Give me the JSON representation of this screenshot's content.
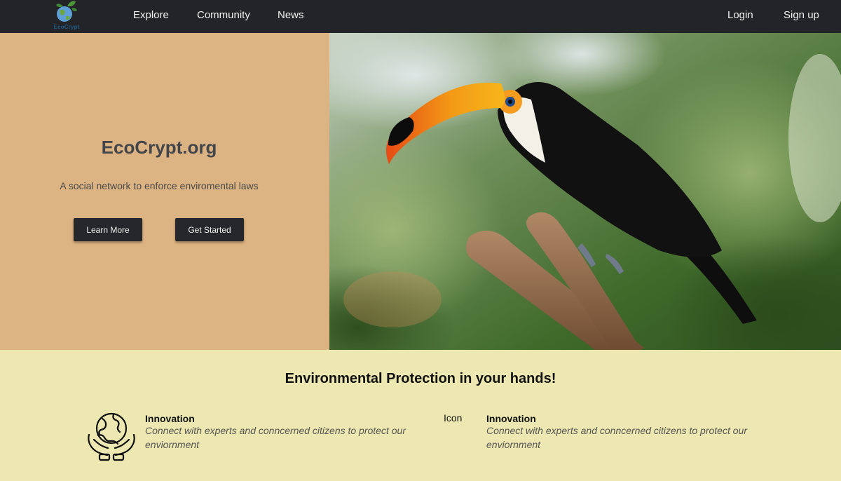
{
  "nav": {
    "logo_text": "EcoCrypt",
    "links": [
      "Explore",
      "Community",
      "News"
    ],
    "login": "Login",
    "signup": "Sign up"
  },
  "hero": {
    "title": "EcoCrypt.org",
    "subtitle": "A social network to enforce enviromental laws",
    "learn_more": "Learn More",
    "get_started": "Get Started",
    "image_icon": "toucan-photo"
  },
  "features": {
    "heading": "Environmental Protection in your hands!",
    "items": [
      {
        "icon": "globe-hands-icon",
        "title": "Innovation",
        "description": "Connect with experts and conncerned citizens to protect our enviornment"
      },
      {
        "icon_text": "Icon",
        "title": "Innovation",
        "description": "Connect with experts and conncerned citizens to protect our enviornment"
      }
    ]
  },
  "colors": {
    "navbar": "#232427",
    "hero_left": "#dcb382",
    "features_bg": "#ede8b1",
    "button": "#26272a"
  }
}
